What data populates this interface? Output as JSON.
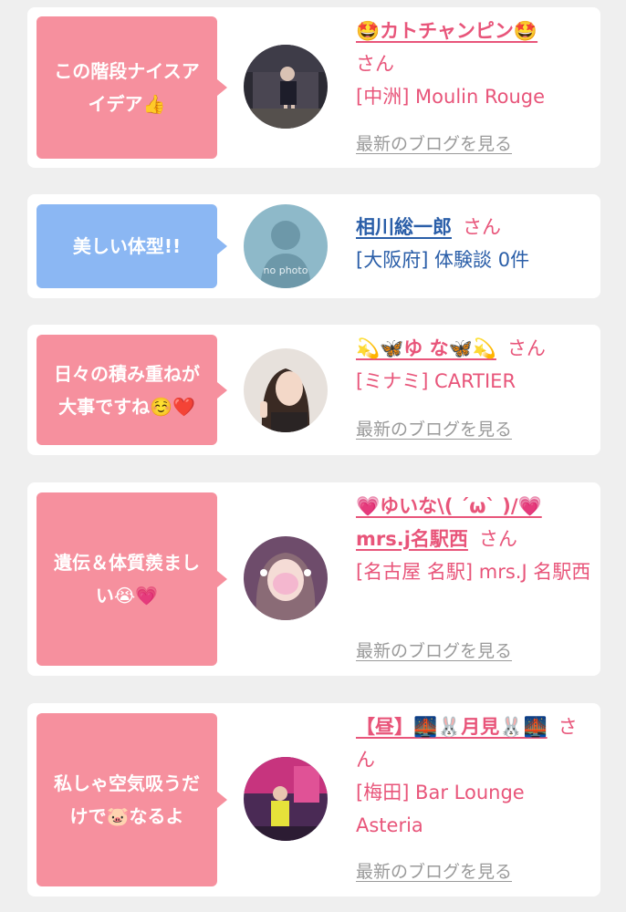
{
  "cards": [
    {
      "comment": "この階段ナイスアイデア👍",
      "bubble_color": "#f6909e",
      "name": "🤩カトチャンピン🤩",
      "honorific": "さん",
      "location": "[中洲] Moulin Rouge",
      "blog_link": "最新のブログを見る"
    },
    {
      "comment": "美しい体型!!",
      "bubble_color": "#8bb7f3",
      "name": "相川総一郎",
      "honorific": "さん",
      "location": "[大阪府] 体験談 0件",
      "avatar_text": "no photo"
    },
    {
      "comment": "日々の積み重ねが大事ですね☺️❤️",
      "bubble_color": "#f6909e",
      "name": "💫🦋ゆ な🦋💫",
      "honorific": "さん",
      "location": "[ミナミ] CARTIER",
      "blog_link": "最新のブログを見る"
    },
    {
      "comment": "遺伝＆体質羨ましい😭💗",
      "bubble_color": "#f6909e",
      "name": "💗ゆいな\\( ´ω` )/💗mrs.j名駅西",
      "honorific": "さん",
      "location": "[名古屋 名駅] mrs.J 名駅西",
      "blog_link": "最新のブログを見る"
    },
    {
      "comment": "私しゃ空気吸うだけで🐷なるよ",
      "bubble_color": "#f6909e",
      "name": "【昼】🌉🐰月見🐰🌉",
      "honorific": "さん",
      "location": "[梅田] Bar Lounge Asteria",
      "blog_link": "最新のブログを見る"
    }
  ]
}
